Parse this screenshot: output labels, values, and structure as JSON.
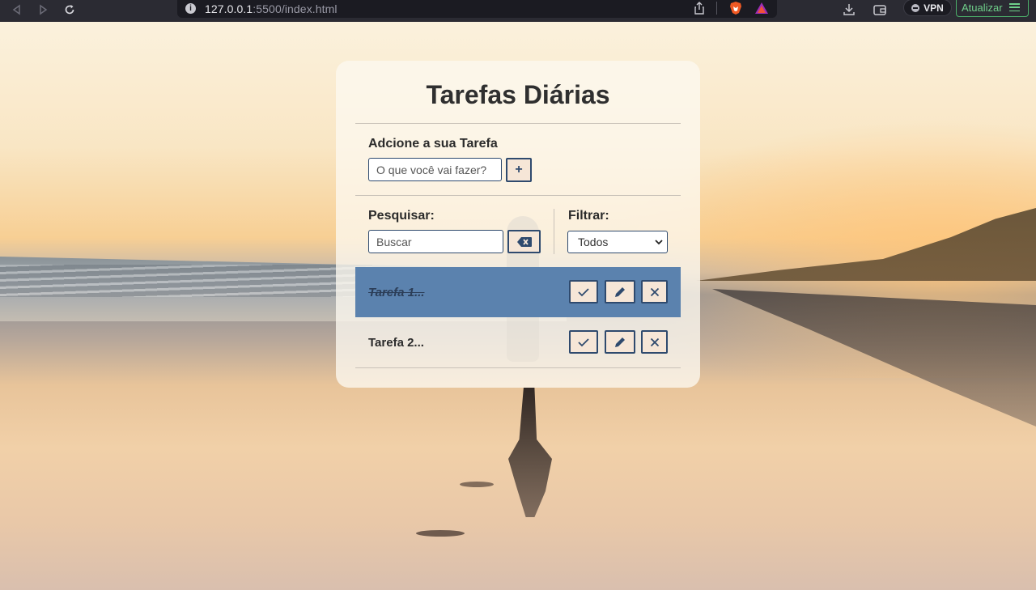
{
  "browser": {
    "url_host": "127.0.0.1",
    "url_rest": ":5500/index.html",
    "vpn_label": "VPN",
    "update_label": "Atualizar"
  },
  "app": {
    "title": "Tarefas Diárias",
    "add_section_label": "Adcione a sua Tarefa",
    "add_placeholder": "O que você vai fazer?",
    "add_button_label": "+",
    "search_label": "Pesquisar:",
    "search_placeholder": "Buscar",
    "filter_label": "Filtrar:",
    "filter_selected": "Todos",
    "todos": [
      {
        "text": "Tarefa 1...",
        "done": true
      },
      {
        "text": "Tarefa 2...",
        "done": false
      }
    ]
  },
  "colors": {
    "accent": "#2f4a6e",
    "done_row": "#5b82ae",
    "button_bg": "#f6e6d7"
  }
}
